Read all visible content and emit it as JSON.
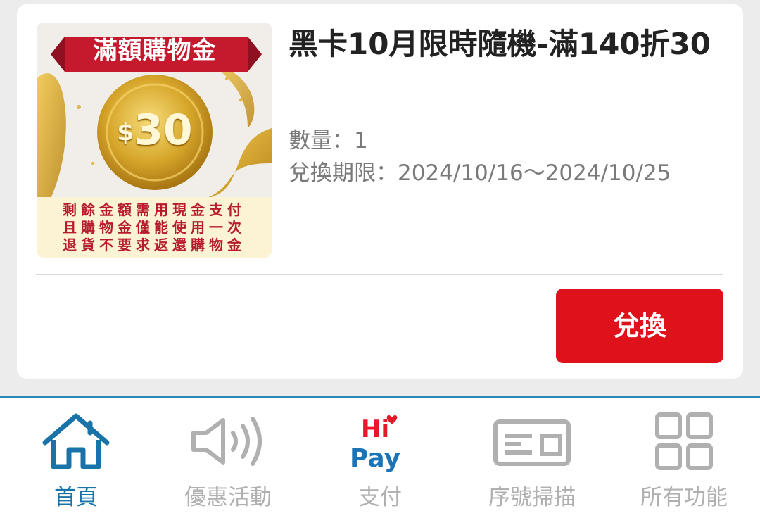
{
  "card": {
    "thumbnail": {
      "banner": "滿額購物金",
      "coin_amount": "30",
      "coin_currency": "$",
      "note_lines": [
        "剩餘金額需用現金支付",
        "且購物金僅能使用一次",
        "退貨不要求返還購物金"
      ]
    },
    "title": "黑卡10月限時隨機-滿140折30",
    "quantity": "數量：1",
    "redeem_period": "兌換期限：2024/10/16～2024/10/25",
    "redeem_button": "兌換"
  },
  "tabbar": {
    "items": [
      {
        "label": "首頁",
        "icon": "home-icon",
        "active": true
      },
      {
        "label": "優惠活動",
        "icon": "speaker-icon",
        "active": false
      },
      {
        "label": "支付",
        "icon": "hipay-logo",
        "active": false
      },
      {
        "label": "序號掃描",
        "icon": "barcode-scan-icon",
        "active": false
      },
      {
        "label": "所有功能",
        "icon": "grid-icon",
        "active": false
      }
    ]
  },
  "colors": {
    "accent": "#df121b",
    "active_tab": "#1a73a8",
    "inactive_tab": "#b0b0b0",
    "hipay_red": "#e6192b",
    "hipay_blue": "#1b74b8"
  }
}
